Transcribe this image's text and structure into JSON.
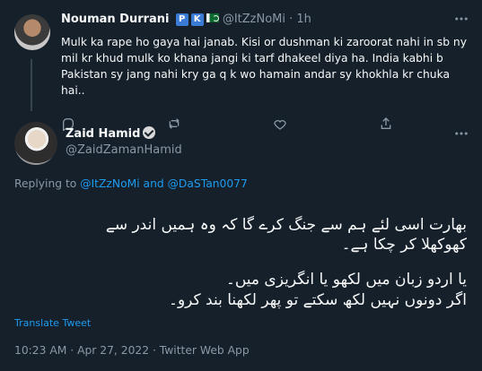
{
  "reply_tweet": {
    "name": "Nouman Durrani",
    "badges": [
      "P",
      "K"
    ],
    "flag_icon": "pakistan-flag-icon",
    "handle": "@ItZzNoMi",
    "separator": "·",
    "time": "1h",
    "text": "Mulk ka rape ho gaya hai janab. Kisi or dushman ki zaroorat nahi in sb ny mil kr khud mulk ko khana jangi ki tarf dhakeel diya ha. India kabhi b Pakistan sy jang nahi kry ga q k wo hamain andar sy khokhla kr chuka hai..",
    "more_icon": "more-horizontal-icon",
    "actions": [
      "reply-icon",
      "retweet-icon",
      "like-icon",
      "share-icon"
    ]
  },
  "main_tweet": {
    "name": "Zaid Hamid",
    "handle": "@ZaidZamanHamid",
    "replying_prefix": "Replying to",
    "replying_user1": "@ItZzNoMi",
    "replying_and": "and",
    "replying_user2": "@DaSTan0077",
    "urdu_lines": [
      "بھارت اسی لئے ہم سے جنگ کرے گا کہ وہ ہمیں اندر سے",
      "کھوکھلا کر چکا ہے۔",
      "یا اردو زبان میں لکھو یا انگریزی میں۔",
      "اگر دونوں نہیں لکھ سکتے تو پھر لکھنا بند کرو۔"
    ],
    "translate_label": "Translate Tweet",
    "meta": "10:23 AM · Apr 27, 2022 · Twitter Web App",
    "more_icon": "more-horizontal-icon"
  },
  "colors": {
    "background": "#15202b",
    "text": "#f7f9f9",
    "muted": "#8b98a5",
    "link": "#1d9bf0"
  }
}
